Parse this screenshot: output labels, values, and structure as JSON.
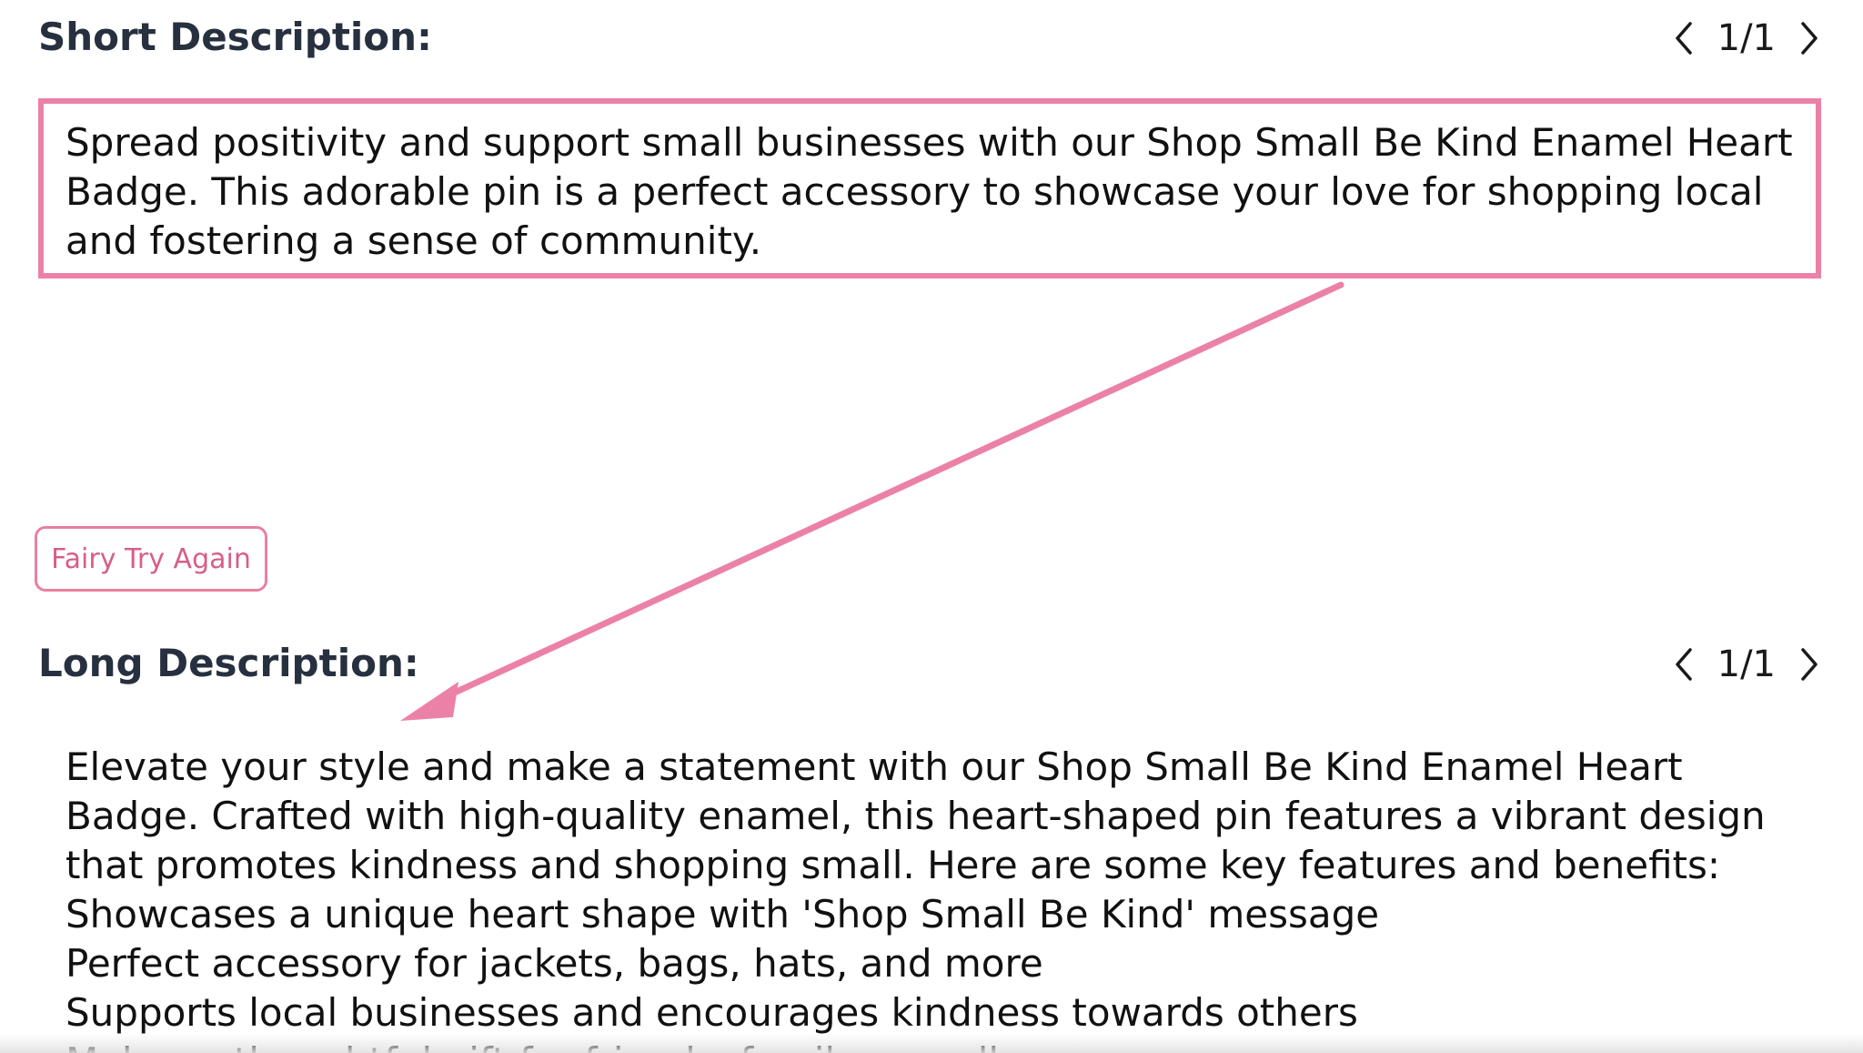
{
  "short_description": {
    "title": "Short Description:",
    "pager": "1/1",
    "text": "Spread positivity and support small businesses with our Shop Small Be Kind Enamel Heart Badge. This adorable pin is a perfect accessory to showcase your love for shopping local and fostering a sense of community."
  },
  "try_again_label": "Fairy Try Again",
  "long_description": {
    "title": "Long Description:",
    "pager": "1/1",
    "lines": [
      "Elevate your style and make a statement with our Shop Small Be Kind Enamel Heart",
      "Badge. Crafted with high-quality enamel, this heart-shaped pin features a vibrant design",
      "that promotes kindness and shopping small. Here are some key features and benefits:",
      "Showcases a unique heart shape with 'Shop Small Be Kind' message",
      "Perfect accessory for jackets, bags, hats, and more",
      "Supports local businesses and encourages kindness towards others",
      "Makes a thoughtful gift for friends, family, or colleagues"
    ]
  },
  "colors": {
    "highlight": "#ec81a8",
    "button_border": "#e97f9f",
    "button_text": "#d65f86",
    "heading": "#27303f"
  }
}
